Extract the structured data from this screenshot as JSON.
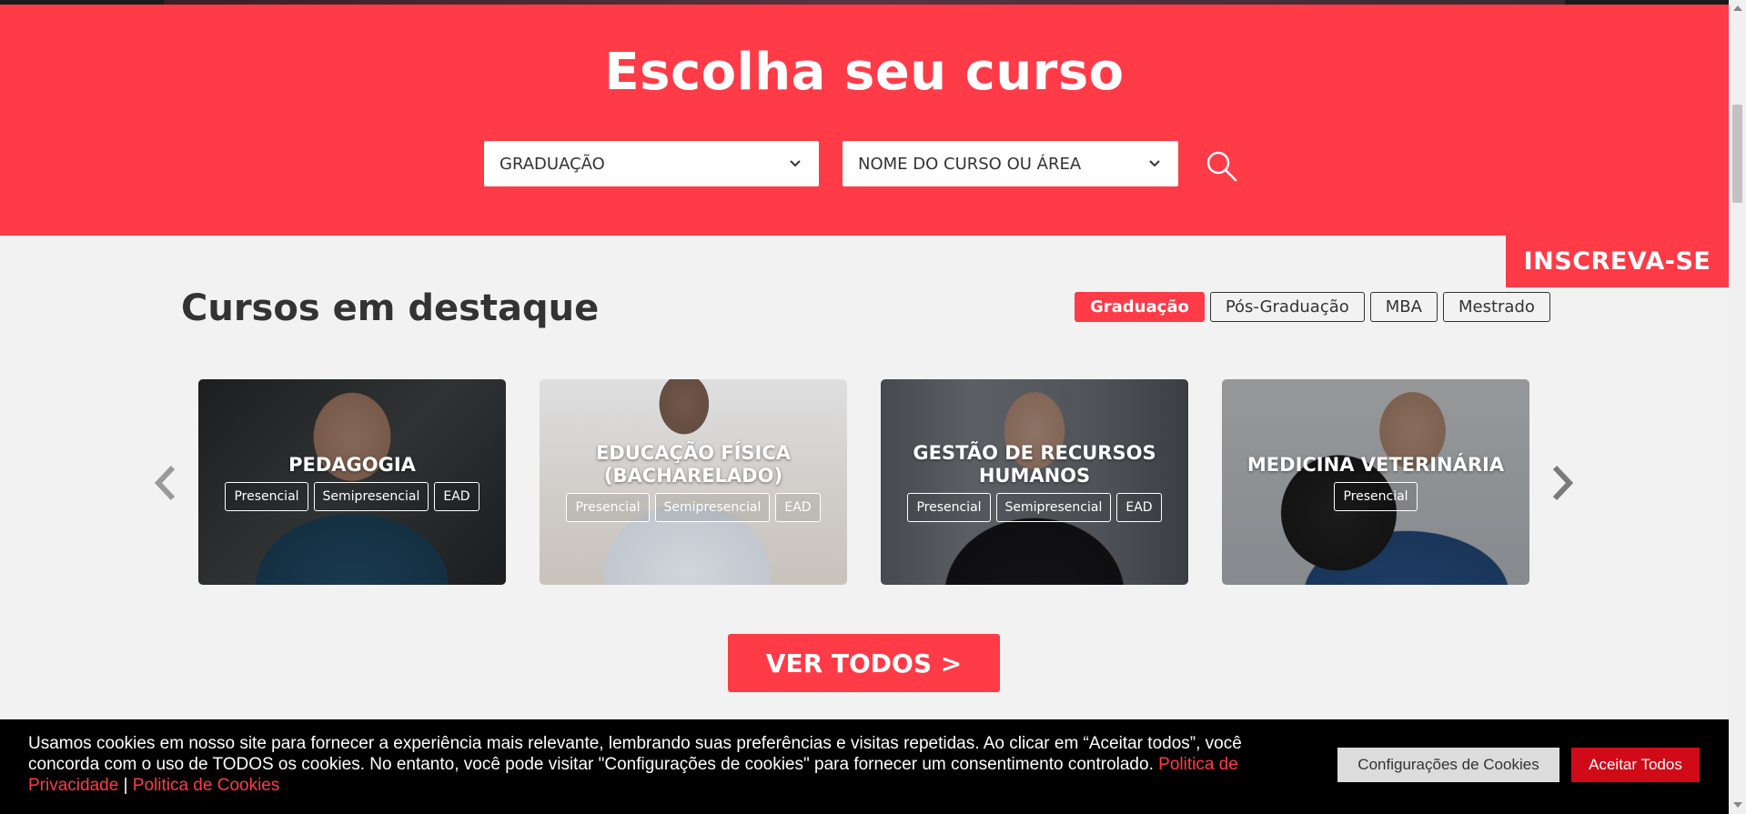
{
  "hero": {
    "title": "Escolha seu curso",
    "select_level": "GRADUAÇÃO",
    "select_course": "NOME DO CURSO OU ÁREA",
    "search_icon": "search-icon"
  },
  "inscreva": "INSCREVA-SE",
  "section": {
    "title": "Cursos em destaque",
    "tabs": [
      {
        "label": "Graduação",
        "active": true
      },
      {
        "label": "Pós-Graduação",
        "active": false
      },
      {
        "label": "MBA",
        "active": false
      },
      {
        "label": "Mestrado",
        "active": false
      }
    ]
  },
  "courses": [
    {
      "title": "PEDAGOGIA",
      "modes": [
        "Presencial",
        "Semipresencial",
        "EAD"
      ]
    },
    {
      "title": "EDUCAÇÃO FÍSICA (BACHARELADO)",
      "modes": [
        "Presencial",
        "Semipresencial",
        "EAD"
      ]
    },
    {
      "title": "GESTÃO DE RECURSOS HUMANOS",
      "modes": [
        "Presencial",
        "Semipresencial",
        "EAD"
      ]
    },
    {
      "title": "MEDICINA VETERINÁRIA",
      "modes": [
        "Presencial"
      ]
    }
  ],
  "ver_todos": "VER TODOS >",
  "cookie": {
    "text": "Usamos cookies em nosso site para fornecer a experiência mais relevante, lembrando suas preferências e visitas repetidas. Ao clicar em “Aceitar todos”, você concorda com o uso de TODOS os cookies. No entanto, você pode visitar \"Configurações de cookies\" para fornecer um consentimento controlado.",
    "link_privacy": "Politica de Privacidade",
    "separator": "|",
    "link_cookies": "Politica de Cookies",
    "btn_config": "Configurações de Cookies",
    "btn_accept": "Aceitar Todos"
  },
  "colors": {
    "brand_red": "#ff3b47",
    "accept_red": "#d10a17"
  }
}
